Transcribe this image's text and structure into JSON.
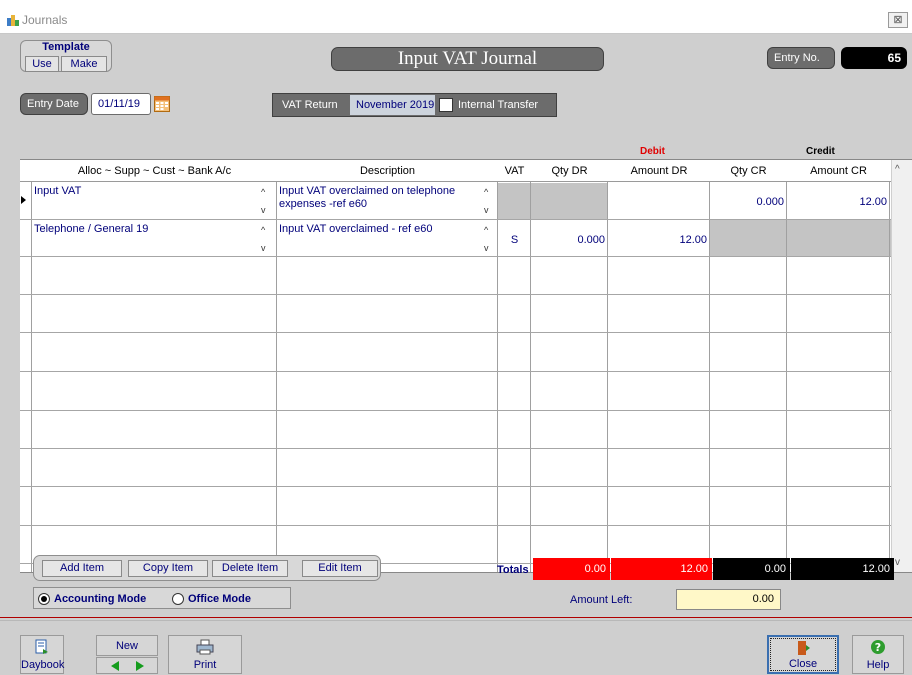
{
  "window": {
    "title": "Journals",
    "close_glyph": "⊠"
  },
  "template": {
    "label": "Template",
    "use": "Use",
    "make": "Make"
  },
  "journal_title": "Input VAT Journal",
  "entry_no": {
    "label": "Entry No.",
    "value": "65"
  },
  "entry_date": {
    "label": "Entry Date",
    "value": "01/11/19"
  },
  "vat_return": {
    "label": "VAT Return",
    "value": "November 2019",
    "internal_transfer_label": "Internal Transfer",
    "internal_transfer_checked": false
  },
  "group_headers": {
    "debit": "Debit",
    "credit": "Credit"
  },
  "columns": [
    "Alloc ~ Supp ~ Cust ~ Bank A/c",
    "Description",
    "VAT",
    "Qty DR",
    "Amount DR",
    "Qty CR",
    "Amount CR"
  ],
  "rows": [
    {
      "account": "Input VAT",
      "description": "Input VAT overclaimed on telephone expenses -ref e60",
      "vat": "",
      "qty_dr": "",
      "amount_dr": "",
      "qty_cr": "0.000",
      "amount_cr": "12.00"
    },
    {
      "account": "Telephone / General 19",
      "description": "Input VAT overclaimed  - ref e60",
      "vat": "S",
      "qty_dr": "0.000",
      "amount_dr": "12.00",
      "qty_cr": "",
      "amount_cr": ""
    }
  ],
  "actions": {
    "add": "Add Item",
    "copy": "Copy Item",
    "delete": "Delete Item",
    "edit": "Edit Item"
  },
  "modes": {
    "accounting": "Accounting Mode",
    "office": "Office Mode",
    "selected": "accounting"
  },
  "totals": {
    "label": "Totals",
    "qty_dr": "0.00",
    "amount_dr": "12.00",
    "qty_cr": "0.00",
    "amount_cr": "12.00"
  },
  "amount_left": {
    "label": "Amount Left:",
    "value": "0.00"
  },
  "footer": {
    "daybook": "Daybook",
    "new": "New",
    "print": "Print",
    "close": "Close",
    "help": "Help"
  },
  "colors": {
    "debit_total_bg": "#ff0000",
    "credit_total_bg": "#000000",
    "amount_left_bg": "#fff8c8",
    "accent_text": "#00007a"
  }
}
